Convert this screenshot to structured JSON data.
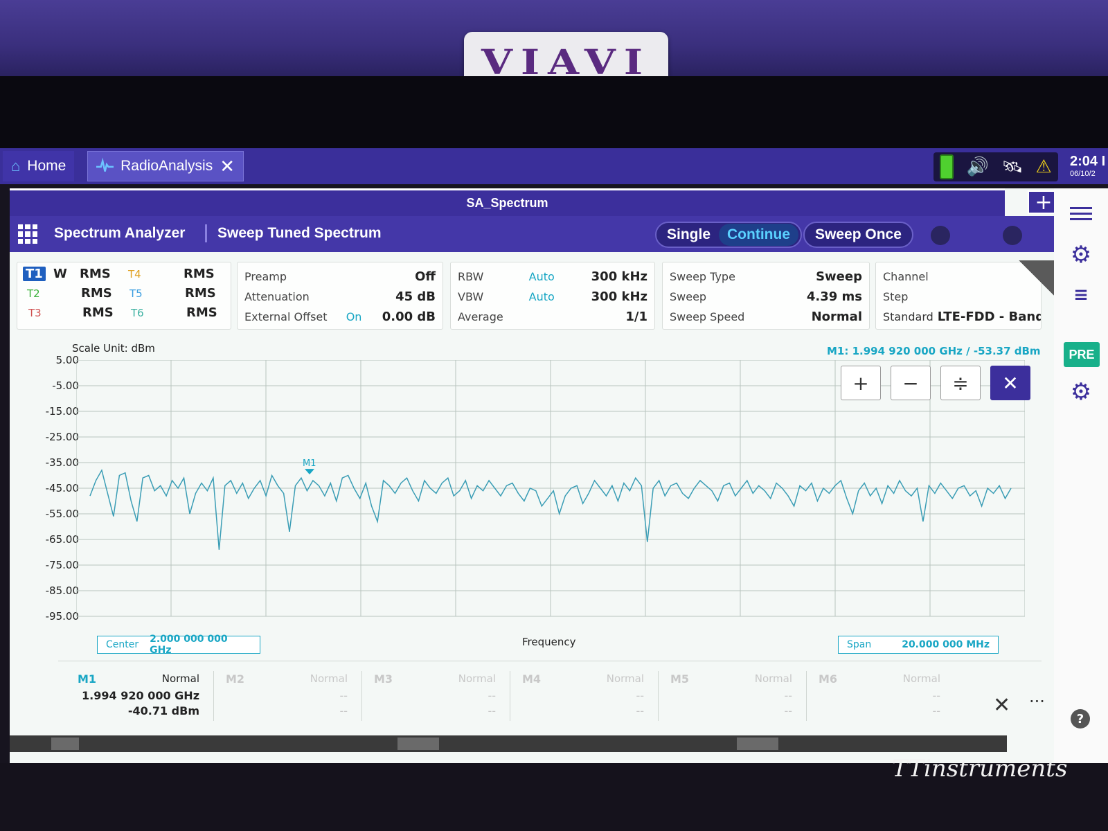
{
  "device": {
    "logo": "VIAVI",
    "watermark": "TTinstruments"
  },
  "os_tabs": [
    {
      "label": "Home",
      "icon": "home-icon"
    },
    {
      "label": "RadioAnalysis",
      "icon": "waveform-icon"
    }
  ],
  "clock": {
    "time": "2:04 I",
    "date": "06/10/2"
  },
  "window": {
    "title": "SA_Spectrum"
  },
  "toolbar": {
    "mode": "Spectrum Analyzer",
    "measurement": "Sweep Tuned Spectrum",
    "single": "Single",
    "continue": "Continue",
    "sweep_once": "Sweep Once"
  },
  "traces": {
    "t1": "T1",
    "t1_mode": "W",
    "t1_det": "RMS",
    "t2": "T2",
    "t2_det": "RMS",
    "t3": "T3",
    "t3_det": "RMS",
    "t4": "T4",
    "t4_det": "RMS",
    "t5": "T5",
    "t5_det": "RMS",
    "t6": "T6",
    "t6_det": "RMS"
  },
  "amplitude": {
    "preamp_label": "Preamp",
    "preamp": "Off",
    "atten_label": "Attenuation",
    "atten": "45 dB",
    "ext_label": "External Offset",
    "ext_state": "On",
    "ext": "0.00 dB"
  },
  "bandwidth": {
    "rbw_label": "RBW",
    "rbw_mode": "Auto",
    "rbw": "300 kHz",
    "vbw_label": "VBW",
    "vbw_mode": "Auto",
    "vbw": "300 kHz",
    "avg_label": "Average",
    "avg": "1/1"
  },
  "sweep": {
    "type_label": "Sweep Type",
    "type": "Sweep",
    "time_label": "Sweep",
    "time": "4.39 ms",
    "speed_label": "Sweep Speed",
    "speed": "Normal"
  },
  "channel": {
    "channel_label": "Channel",
    "step_label": "Step",
    "standard_label": "Standard",
    "standard": "LTE-FDD - Band"
  },
  "plot": {
    "scale_unit": "Scale Unit: dBm",
    "marker_readout": "M1: 1.994 920 000 GHz / -53.37 dBm",
    "marker_label": "M1",
    "xlabel": "Frequency",
    "center_label": "Center",
    "center": "2.000 000 000 GHz",
    "span_label": "Span",
    "span": "20.000 000 MHz",
    "trace_color": "#3a9db5"
  },
  "chart_data": {
    "type": "line",
    "xlabel": "Frequency",
    "ylabel": "Scale Unit: dBm",
    "yticks": [
      "5.00",
      "-5.00",
      "-15.00",
      "-25.00",
      "-35.00",
      "-45.00",
      "-55.00",
      "-65.00",
      "-75.00",
      "-85.00",
      "-95.00"
    ],
    "ylim": [
      -95,
      5
    ],
    "xlim_ghz": [
      1.99,
      2.01
    ],
    "series": [
      {
        "values": [
          -48,
          -42,
          -38,
          -47,
          -56,
          -40,
          -39,
          -50,
          -58,
          -41,
          -40,
          -46,
          -44,
          -48,
          -42,
          -45,
          -41,
          -55,
          -47,
          -43,
          -46,
          -41,
          -69,
          -44,
          -42,
          -47,
          -43,
          -49,
          -45,
          -42,
          -48,
          -40,
          -44,
          -47,
          -62,
          -44,
          -41,
          -46,
          -42,
          -44,
          -48,
          -43,
          -50,
          -41,
          -40,
          -45,
          -49,
          -43,
          -52,
          -58,
          -42,
          -44,
          -47,
          -43,
          -41,
          -46,
          -50,
          -42,
          -45,
          -47,
          -43,
          -41,
          -48,
          -46,
          -42,
          -49,
          -44,
          -46,
          -42,
          -45,
          -48,
          -44,
          -43,
          -47,
          -50,
          -45,
          -46,
          -52,
          -49,
          -46,
          -55,
          -48,
          -45,
          -44,
          -51,
          -47,
          -42,
          -45,
          -48,
          -44,
          -50,
          -43,
          -46,
          -41,
          -44,
          -66,
          -45,
          -42,
          -48,
          -44,
          -43,
          -47,
          -49,
          -45,
          -42,
          -44,
          -46,
          -50,
          -44,
          -43,
          -48,
          -45,
          -42,
          -47,
          -44,
          -46,
          -49,
          -43,
          -45,
          -48,
          -52,
          -44,
          -46,
          -43,
          -50,
          -45,
          -47,
          -44,
          -42,
          -49,
          -55,
          -46,
          -43,
          -48,
          -45,
          -51,
          -44,
          -47,
          -42,
          -46,
          -48,
          -45,
          -58,
          -44,
          -47,
          -43,
          -46,
          -49,
          -45,
          -44,
          -48,
          -46,
          -52,
          -45,
          -47,
          -44,
          -49,
          -45
        ]
      }
    ]
  },
  "markers": [
    {
      "name": "M1",
      "mode": "Normal",
      "v1": "1.994 920 000 GHz",
      "v2": "-40.71 dBm",
      "on": true
    },
    {
      "name": "M2",
      "mode": "Normal",
      "v1": "--",
      "v2": "--",
      "on": false
    },
    {
      "name": "M3",
      "mode": "Normal",
      "v1": "--",
      "v2": "--",
      "on": false
    },
    {
      "name": "M4",
      "mode": "Normal",
      "v1": "--",
      "v2": "--",
      "on": false
    },
    {
      "name": "M5",
      "mode": "Normal",
      "v1": "--",
      "v2": "--",
      "on": false
    },
    {
      "name": "M6",
      "mode": "Normal",
      "v1": "--",
      "v2": "--",
      "on": false
    }
  ],
  "rail": {
    "pre": "PRE",
    "help": "?",
    "more": "..."
  },
  "zoom": {
    "in": "+",
    "out": "−",
    "fit": "≑",
    "close": "✕"
  },
  "plus_tab": "+",
  "close_glyph": "✕"
}
